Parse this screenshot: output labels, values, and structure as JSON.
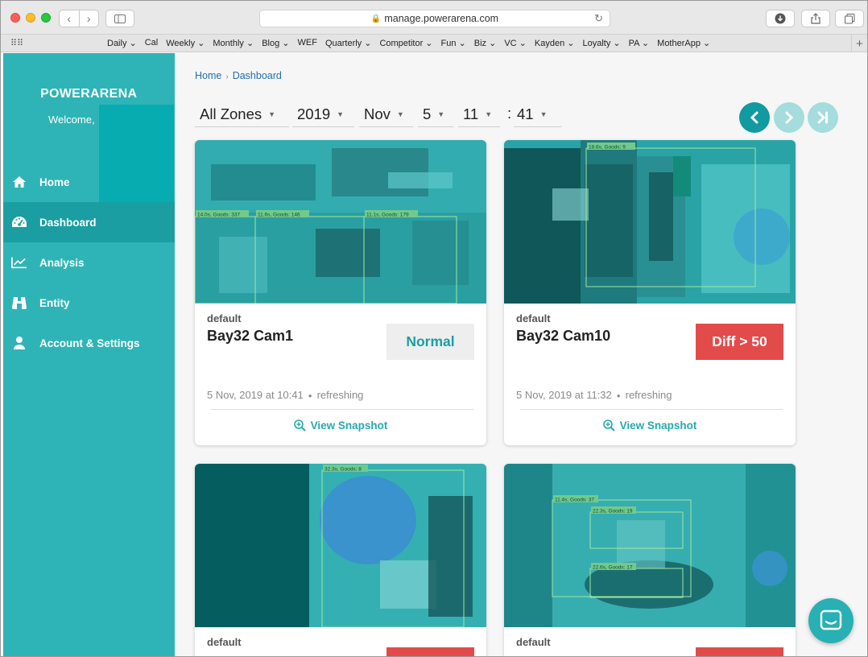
{
  "browser": {
    "url": "manage.powerarena.com",
    "bookmarks": [
      "Daily ⌄",
      "Cal",
      "Weekly ⌄",
      "Monthly ⌄",
      "Blog ⌄",
      "WEF",
      "Quarterly ⌄",
      "Competitor ⌄",
      "Fun ⌄",
      "Biz ⌄",
      "VC ⌄",
      "Kayden ⌄",
      "Loyalty ⌄",
      "PA ⌄",
      "MotherApp ⌄"
    ]
  },
  "sidebar": {
    "brand": "POWERARENA",
    "welcome": "Welcome,",
    "items": [
      {
        "label": "Home",
        "icon": "home-icon"
      },
      {
        "label": "Dashboard",
        "icon": "dashboard-icon"
      },
      {
        "label": "Analysis",
        "icon": "chart-line-icon"
      },
      {
        "label": "Entity",
        "icon": "binoculars-icon"
      },
      {
        "label": "Account & Settings",
        "icon": "user-icon"
      }
    ]
  },
  "breadcrumb": {
    "home": "Home",
    "current": "Dashboard"
  },
  "filters": {
    "zone": "All Zones",
    "year": "2019",
    "month": "Nov",
    "day": "5",
    "hour": "11",
    "colon": ":",
    "minute": "41"
  },
  "cards": [
    {
      "zone": "default",
      "name": "Bay32 Cam1",
      "status": "Normal",
      "timestamp": "5 Nov, 2019 at 10:41",
      "state": "refreshing",
      "action": "View Snapshot",
      "boxes": [
        "14.0s, Goods: 337",
        "11.6s, Goods: 146",
        "11.1s, Goods: 179"
      ]
    },
    {
      "zone": "default",
      "name": "Bay32 Cam10",
      "status": "Diff > 50",
      "timestamp": "5 Nov, 2019 at 11:32",
      "state": "refreshing",
      "action": "View Snapshot",
      "boxes": [
        "18.6s, Goods: 9"
      ]
    },
    {
      "zone": "default",
      "boxes": [
        "32.3s, Goods: 8"
      ]
    },
    {
      "zone": "default",
      "boxes": [
        "11.4s, Goods: 37",
        "22.3s, Goods: 19",
        "22.6s, Goods: 17"
      ]
    }
  ],
  "colors": {
    "sidebar": "#2eb4b6",
    "sidebar_active": "#1a9ea1",
    "accent": "#119a9f",
    "alert": "#e34b4b",
    "link": "#1f6fb2"
  }
}
